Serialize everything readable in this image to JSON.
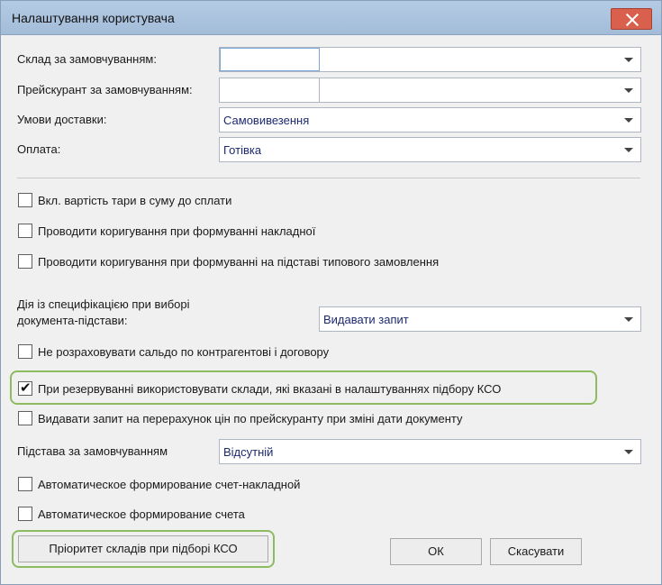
{
  "window": {
    "title": "Налаштування користувача"
  },
  "fields": {
    "warehouse": {
      "label": "Склад за замовчуванням:",
      "code": "",
      "value": ""
    },
    "pricelist": {
      "label": "Прейскурант за замовчуванням:",
      "code": "",
      "value": ""
    },
    "delivery": {
      "label": "Умови доставки:",
      "value": "Самовивезення"
    },
    "payment": {
      "label": "Оплата:",
      "value": "Готівка"
    }
  },
  "checks": {
    "tare": {
      "label": "Вкл. вартість тари в суму до сплати",
      "checked": false
    },
    "adjust_invoice": {
      "label": "Проводити коригування при формуванні накладної",
      "checked": false
    },
    "adjust_typical": {
      "label": "Проводити коригування при формуванні на підставі типового замовлення",
      "checked": false
    }
  },
  "spec_action": {
    "label_line1": "Дія із специфікацією при виборі",
    "label_line2": "документа-підстави:",
    "value": "Видавати запит"
  },
  "checks2": {
    "no_balance": {
      "label": "Не розраховувати сальдо по контрагентові і договору",
      "checked": false
    },
    "reserve_kso": {
      "label": "При резервуванні використовувати склади, які вказані в налаштуваннях підбору КСО",
      "checked": true
    },
    "recalc_prices": {
      "label": "Видавати запит на перерахунок цін по прейскуранту при зміні дати документу",
      "checked": false
    }
  },
  "basis": {
    "label": "Підстава за замовчуванням",
    "value": "Відсутній"
  },
  "checks3": {
    "auto_invoice": {
      "label": "Автоматическое формирование счет-накладной",
      "checked": false
    },
    "auto_bill": {
      "label": "Автоматическое формирование счета",
      "checked": false
    }
  },
  "buttons": {
    "priority": "Пріоритет складів при підборі КСО",
    "ok": "ОК",
    "cancel": "Скасувати"
  },
  "colors": {
    "highlight": "#8dbb62",
    "value_text": "#1d2a6e",
    "close": "#d9604c"
  }
}
